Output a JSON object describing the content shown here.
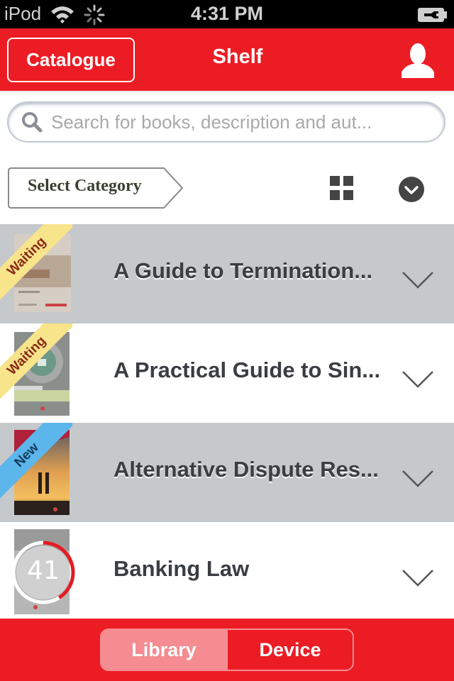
{
  "status_bar": {
    "carrier": "iPod",
    "time": "4:31 PM",
    "wifi_icon": "wifi-icon",
    "activity_icon": "spinner-icon",
    "battery_icon": "battery-charging-icon"
  },
  "navbar": {
    "catalogue_label": "Catalogue",
    "title": "Shelf",
    "profile_icon": "user-icon",
    "accent_color": "#ec1c24"
  },
  "search": {
    "placeholder": "Search for books, description and aut...",
    "value": ""
  },
  "toolbar": {
    "category_label": "Select Category",
    "grid_icon": "grid-view-icon",
    "sort_icon": "chevron-circle-down-icon"
  },
  "books": [
    {
      "title": "A Guide to Termination...",
      "badge": "Waiting"
    },
    {
      "title": "A Practical Guide to Sin...",
      "badge": "Waiting"
    },
    {
      "title": "Alternative Dispute Res...",
      "badge": "New"
    },
    {
      "title": "Banking Law",
      "progress_label": "41",
      "download_progress": 0.41
    }
  ],
  "tabbar": {
    "library_label": "Library",
    "device_label": "Device",
    "selected": "Library"
  }
}
